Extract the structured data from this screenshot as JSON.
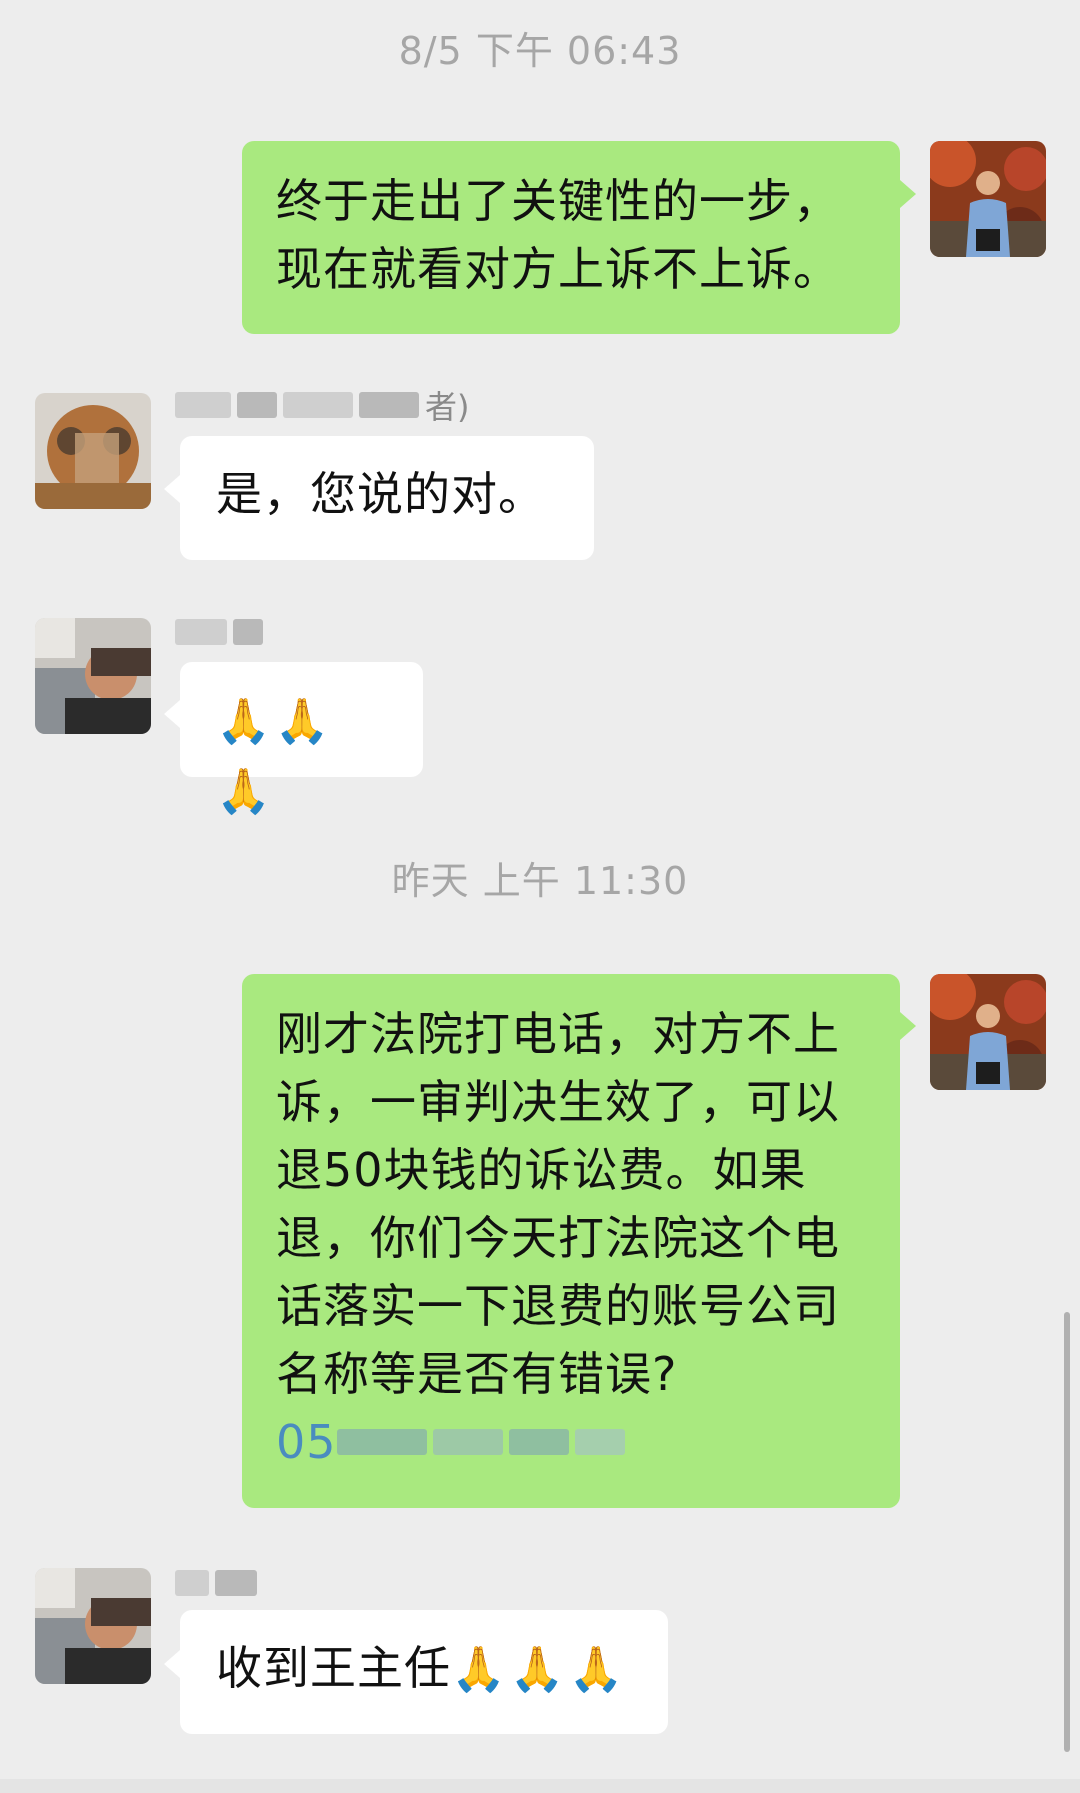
{
  "timestamps": [
    "8/5 下午 06:43",
    "昨天 上午 11:30"
  ],
  "messages": [
    {
      "side": "right",
      "lines": [
        "终于走出了关键性的一步，",
        "现在就看对方上诉不上诉。"
      ]
    },
    {
      "side": "left",
      "sender_visible": "者)",
      "text": "是，您说的对。"
    },
    {
      "side": "left",
      "emoji": "🙏🙏🙏"
    },
    {
      "side": "right",
      "lines": [
        "刚才法院打电话，对方不上",
        "诉，一审判决生效了，可以",
        "退50块钱的诉讼费。如果",
        "退，你们今天打法院这个电",
        "话落实一下退费的账号公司",
        "名称等是否有错误?"
      ],
      "phone_visible": "05"
    },
    {
      "side": "left",
      "text": "收到王主任",
      "emoji": "🙏🙏🙏"
    }
  ]
}
